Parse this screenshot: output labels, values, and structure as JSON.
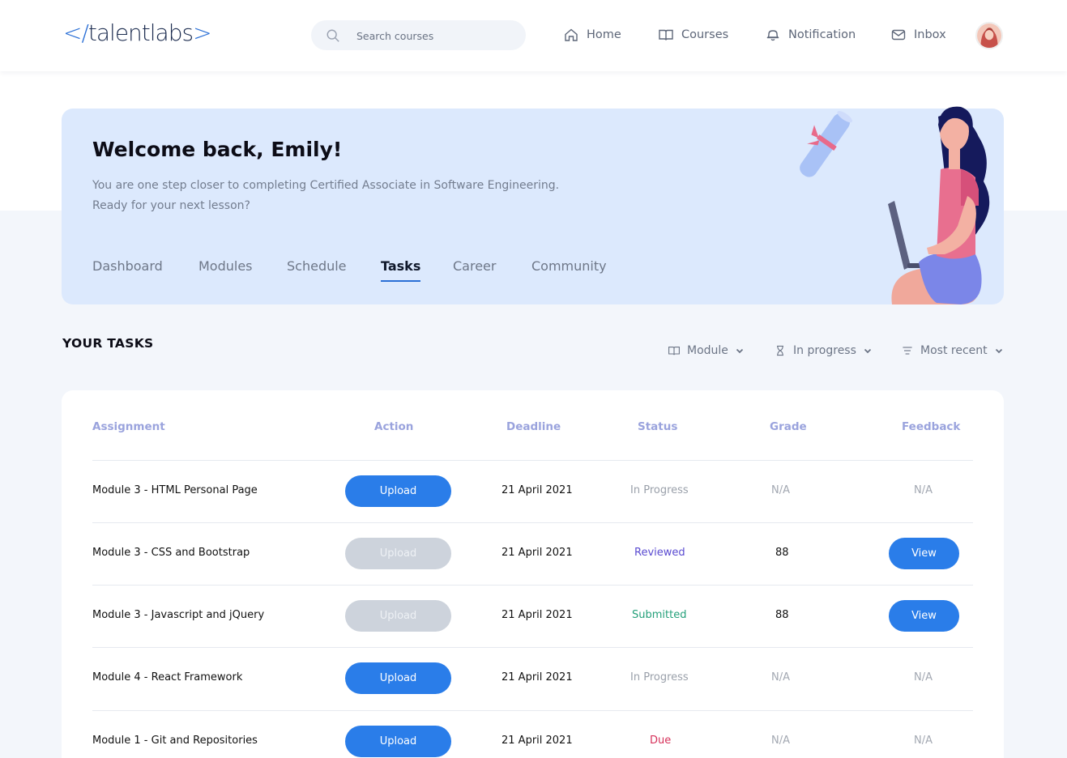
{
  "brand": {
    "logo_open": "</",
    "logo_text": "talentlabs",
    "logo_close": ">"
  },
  "search": {
    "placeholder": "Search courses"
  },
  "nav": {
    "home": "Home",
    "courses": "Courses",
    "notification": "Notification",
    "inbox": "Inbox"
  },
  "hero": {
    "title": "Welcome back, Emily!",
    "subtitle_line1": "You are one step closer to completing Certified Associate in Software Engineering.",
    "subtitle_line2": "Ready for your next lesson?",
    "tabs": [
      "Dashboard",
      "Modules",
      "Schedule",
      "Tasks",
      "Career",
      "Community"
    ],
    "active_tab": "Tasks"
  },
  "tasks": {
    "section_title": "YOUR TASKS",
    "filters": {
      "module": "Module",
      "status": "In progress",
      "sort": "Most recent"
    },
    "headers": {
      "assignment": "Assignment",
      "action": "Action",
      "deadline": "Deadline",
      "status": "Status",
      "grade": "Grade",
      "feedback": "Feedback"
    },
    "rows": [
      {
        "assignment": "Module 3 - HTML Personal Page",
        "action": "Upload",
        "action_enabled": true,
        "deadline": "21 April 2021",
        "status": "In Progress",
        "grade": "N/A",
        "feedback": "N/A"
      },
      {
        "assignment": "Module 3 - CSS and Bootstrap",
        "action": "Upload",
        "action_enabled": false,
        "deadline": "21 April 2021",
        "status": "Reviewed",
        "grade": "88",
        "feedback": "View"
      },
      {
        "assignment": "Module 3 - Javascript and jQuery",
        "action": "Upload",
        "action_enabled": false,
        "deadline": "21 April 2021",
        "status": "Submitted",
        "grade": "88",
        "feedback": "View"
      },
      {
        "assignment": "Module 4 - React Framework",
        "action": "Upload",
        "action_enabled": true,
        "deadline": "21 April 2021",
        "status": "In Progress",
        "grade": "N/A",
        "feedback": "N/A"
      },
      {
        "assignment": "Module 1 - Git and Repositories",
        "action": "Upload",
        "action_enabled": true,
        "deadline": "21 April 2021",
        "status": "Due",
        "grade": "N/A",
        "feedback": "N/A"
      }
    ]
  },
  "colors": {
    "primary": "#2a7de9",
    "hero_bg": "#dce9fd",
    "reviewed": "#5a4bd1",
    "submitted": "#24a07a",
    "due": "#d6315a"
  },
  "icons": {
    "search": "search-icon",
    "home": "home-icon",
    "courses": "book-icon",
    "notification": "bell-icon",
    "inbox": "mail-icon",
    "module_filter": "book-icon",
    "status_filter": "hourglass-icon",
    "sort_filter": "sort-icon",
    "dropdown": "chevron-down-icon"
  }
}
